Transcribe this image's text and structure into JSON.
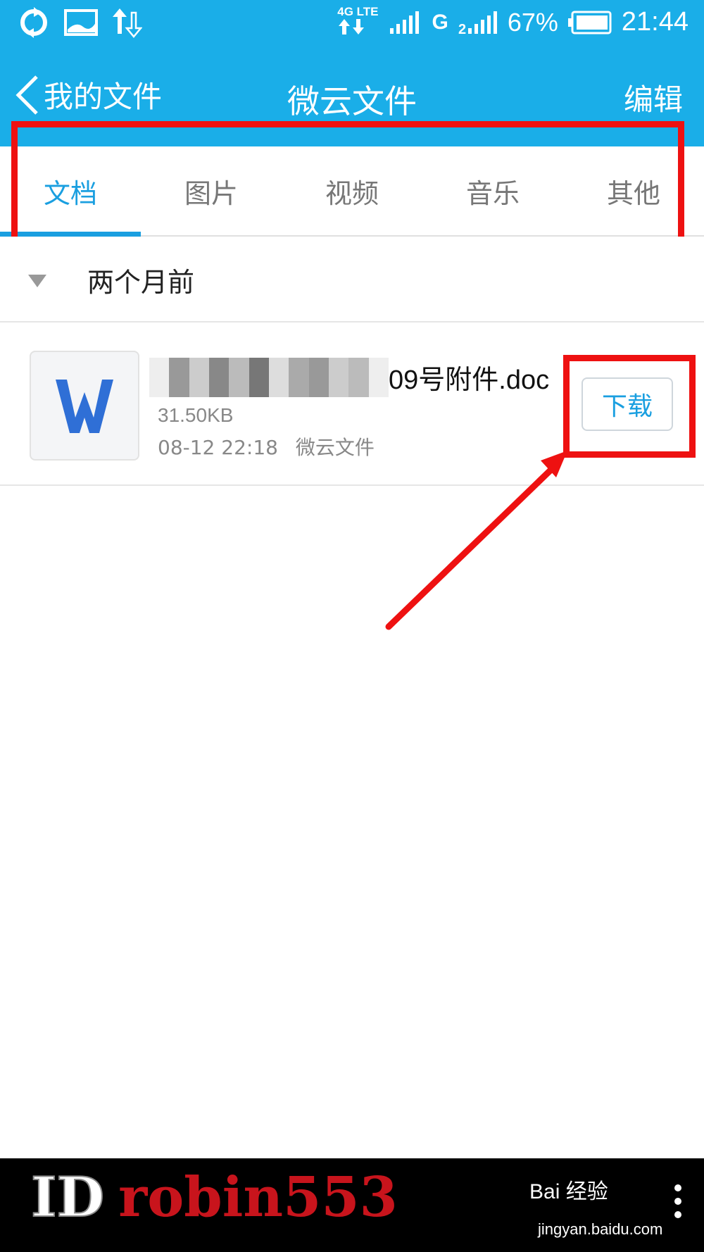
{
  "status_bar": {
    "network_label": "4G LTE",
    "signal_g": "G",
    "battery_percent": "67%",
    "time": "21:44"
  },
  "title_bar": {
    "back_label": "我的文件",
    "title": "微云文件",
    "edit_label": "编辑"
  },
  "tabs": [
    {
      "label": "文档",
      "active": true
    },
    {
      "label": "图片",
      "active": false
    },
    {
      "label": "视频",
      "active": false
    },
    {
      "label": "音乐",
      "active": false
    },
    {
      "label": "其他",
      "active": false
    }
  ],
  "section": {
    "title": "两个月前"
  },
  "file": {
    "name_visible_suffix": "09号附件.doc",
    "size": "31.50KB",
    "date": "08-12 22:18",
    "source": "微云文件",
    "icon": "word-doc-icon",
    "download_label": "下载"
  },
  "colors": {
    "accent": "#1aaee8",
    "tab_active": "#1a9fe0",
    "highlight": "#ee1111"
  },
  "watermark": {
    "id_text": "ID",
    "name_text": "robin553",
    "baidu_logo": "Bai  经验",
    "baidu_url": "jingyan.baidu.com"
  }
}
